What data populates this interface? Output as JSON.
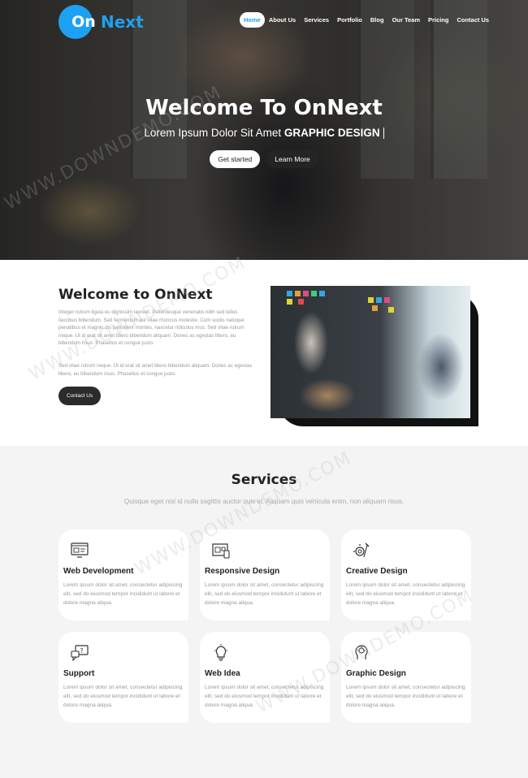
{
  "brand": {
    "logo_on": "On",
    "logo_next": "Next",
    "accent": "#1da1f2"
  },
  "nav": {
    "items": [
      "Home",
      "About Us",
      "Services",
      "Portfolio",
      "Blog",
      "Our Team",
      "Pricing",
      "Contact Us"
    ]
  },
  "hero": {
    "title": "Welcome To OnNext",
    "subtitle_plain": "Lorem Ipsum Dolor Sit Amet",
    "subtitle_bold": "GRAPHIC DESIGN",
    "get_started": "Get started",
    "learn_more": "Learn More"
  },
  "about": {
    "title": "Welcome to OnNext",
    "p1": "Integer rutrum ligula eu dignissim laoreet. Pellentesque venenatis nibh sed tellus faucibus bibendum. Sed fermentum est vitae rhoncus molestie. Cum sociis natoque penatibus et magnis dis parturient montes, nascetur ridiculus mus. Sed vitae rutrum neque. Ut id erat sit amet libero bibendum aliquam. Donec ac egestas libero, eu bibendum risus. Phasellus et congue justo.",
    "p2": "Sed vitae rutrum neque. Ut id erat sit amet libero bibendum aliquam. Donec ac egestas libero, eu bibendum risus. Phasellus et congue justo.",
    "contact_button": "Contact Us"
  },
  "services": {
    "title": "Services",
    "subtitle": "Quisque eget nisl id nulla sagittis auctor quis id. Aliquam quis vehicula enim, non aliquam risus.",
    "cards": [
      {
        "icon": "web-development-icon",
        "title": "Web Development",
        "text": "Lorem ipsum dolor sit amet, consectetur adipiscing elit, sed do eiusmod tempor incididunt ut labore et dolore magna aliqua."
      },
      {
        "icon": "responsive-design-icon",
        "title": "Responsive Design",
        "text": "Lorem ipsum dolor sit amet, consectetur adipiscing elit, sed do eiusmod tempor incididunt ut labore et dolore magna aliqua."
      },
      {
        "icon": "creative-design-icon",
        "title": "Creative Design",
        "text": "Lorem ipsum dolor sit amet, consectetur adipiscing elit, sed do eiusmod tempor incididunt ut labore et dolore magna aliqua."
      },
      {
        "icon": "support-icon",
        "title": "Support",
        "text": "Lorem ipsum dolor sit amet, consectetur adipiscing elit, sed do eiusmod tempor incididunt ut labore et dolore magna aliqua."
      },
      {
        "icon": "web-idea-icon",
        "title": "Web Idea",
        "text": "Lorem ipsum dolor sit amet, consectetur adipiscing elit, sed do eiusmod tempor incididunt ut labore et dolore magna aliqua."
      },
      {
        "icon": "graphic-design-icon",
        "title": "Graphic Design",
        "text": "Lorem ipsum dolor sit amet, consectetur adipiscing elit, sed do eiusmod tempor incididunt ut labore et dolore magna aliqua."
      }
    ]
  },
  "watermark": "WWW.DOWNDEMO.COM"
}
